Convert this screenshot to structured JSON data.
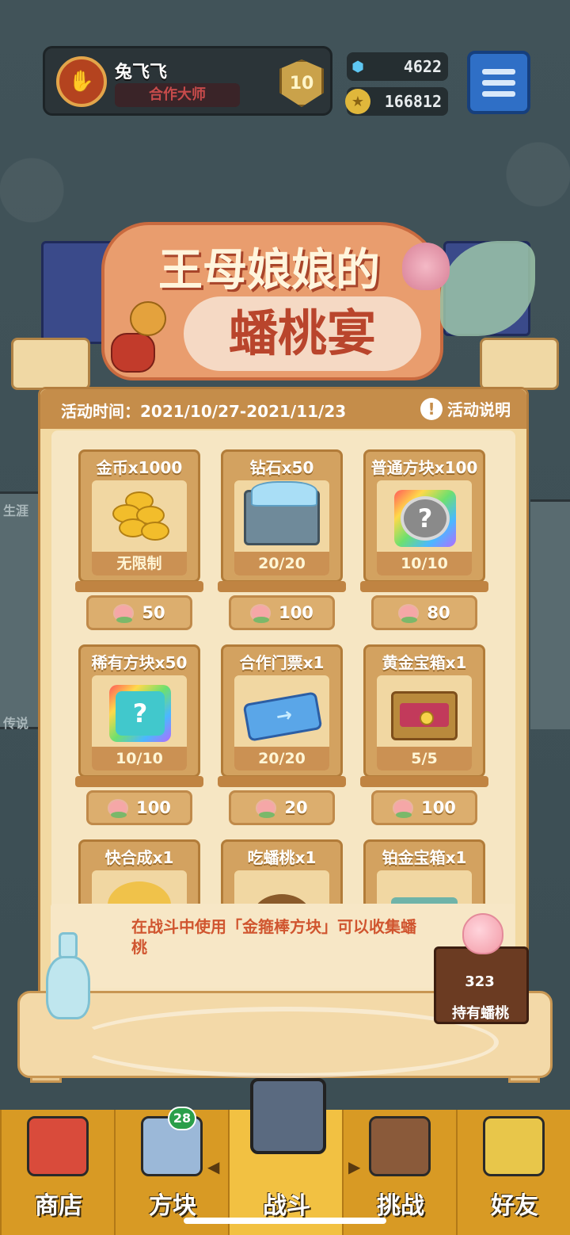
{
  "player": {
    "name": "兔飞飞",
    "title": "合作大师",
    "rank": "10"
  },
  "currency": {
    "gems": "4622",
    "coins": "166812"
  },
  "event": {
    "title_line1": "王母娘娘的",
    "title_line2": "蟠桃宴",
    "time_label": "活动时间：2021/10/27-2021/11/23",
    "info_label": "活动说明",
    "tip": "在战斗中使用「金箍棒方块」可以收集蟠桃"
  },
  "side": {
    "left_labels": [
      "生涯",
      "传说"
    ]
  },
  "shop_items": [
    {
      "name": "金币x1000",
      "stock": "无限制",
      "price": "50",
      "icon": "coin-pile"
    },
    {
      "name": "钻石x50",
      "stock": "20/20",
      "price": "100",
      "icon": "gem-cart"
    },
    {
      "name": "普通方块x100",
      "stock": "10/10",
      "price": "80",
      "icon": "normal-block"
    },
    {
      "name": "稀有方块x50",
      "stock": "10/10",
      "price": "100",
      "icon": "rare-block"
    },
    {
      "name": "合作门票x1",
      "stock": "20/20",
      "price": "20",
      "icon": "ticket"
    },
    {
      "name": "黄金宝箱x1",
      "stock": "5/5",
      "price": "100",
      "icon": "gold-chest"
    },
    {
      "name": "快合成x1",
      "icon": "fruit-monkey"
    },
    {
      "name": "吃蟠桃x1",
      "icon": "peach-bowl"
    },
    {
      "name": "铂金宝箱x1",
      "icon": "platinum-chest"
    }
  ],
  "peaches": {
    "count": "323",
    "label": "持有蟠桃"
  },
  "nav": {
    "items": [
      {
        "label": "商店",
        "icon": "shop-icon"
      },
      {
        "label": "方块",
        "icon": "block-icon"
      },
      {
        "label": "战斗",
        "icon": "battle-icon"
      },
      {
        "label": "挑战",
        "icon": "challenge-icon"
      },
      {
        "label": "好友",
        "icon": "friends-icon"
      }
    ],
    "block_badge": "28"
  },
  "colors": {
    "accent": "#e2a92f",
    "panel": "#f2d9a2",
    "menu_button": "#2f6fc6"
  }
}
